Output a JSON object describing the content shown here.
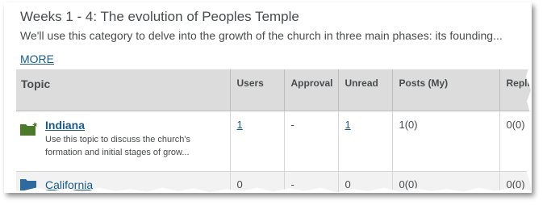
{
  "category": {
    "title": "Weeks 1 - 4: The evolution of Peoples Temple",
    "description": "We'll use this category to delve into the growth of the church in three main phases: its founding...",
    "more_link": "MORE"
  },
  "table": {
    "columns": [
      "Topic",
      "Users",
      "Approval",
      "Unread",
      "Posts (My)",
      "Repli"
    ],
    "rows": [
      {
        "name": "Indiana",
        "description": "Use this topic to discuss the church's formation and initial stages of grow...",
        "icon": "folder-new-icon",
        "users": "1",
        "approval": "-",
        "unread": "1",
        "posts": "1(0)",
        "replies": "0(0)"
      },
      {
        "name": "California",
        "icon": "folder-icon",
        "users": "0",
        "approval": "-",
        "unread": "0",
        "posts": "0(0)",
        "replies": "0(0)"
      }
    ]
  },
  "colors": {
    "link": "#1a5b8a",
    "header_bg": "#dcdcdc",
    "folder_new": "#4a7a2a",
    "folder": "#2f6a9e"
  }
}
